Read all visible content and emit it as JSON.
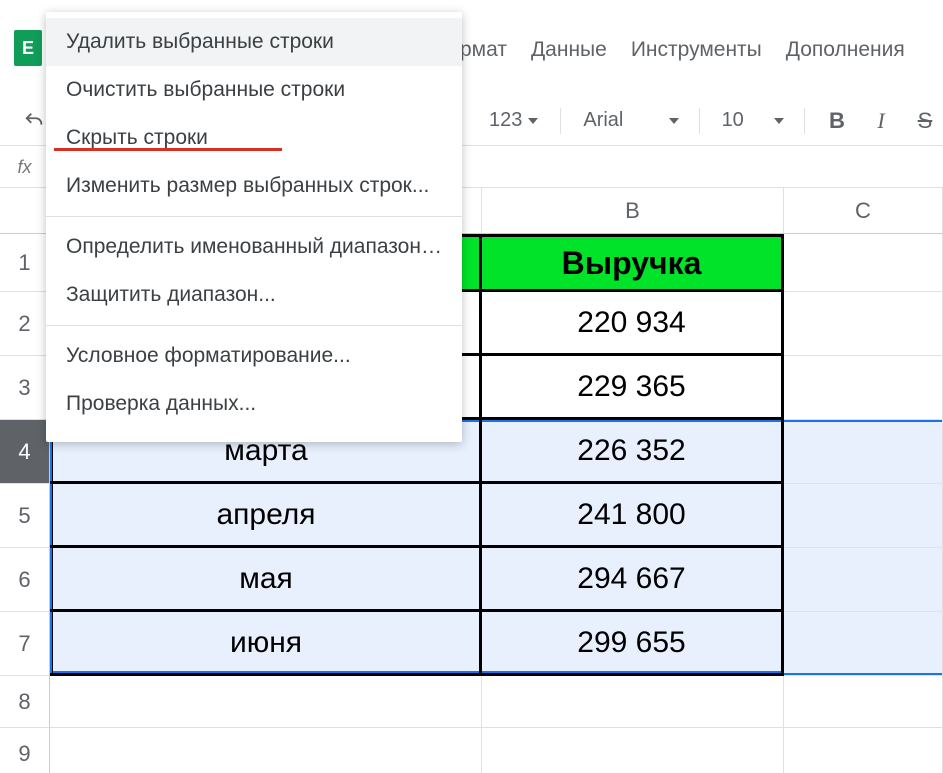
{
  "app_icon_letter": "E",
  "menubar": {
    "format": "рмат",
    "data": "Данные",
    "tools": "Инструменты",
    "addons": "Дополнения"
  },
  "toolbar": {
    "numfmt": "123",
    "font": "Arial",
    "size": "10",
    "bold": "B",
    "italic": "I",
    "strike": "S"
  },
  "formula_bar": {
    "fx": "fx",
    "value": ""
  },
  "columns": {
    "b": "B",
    "c": "C"
  },
  "rows": {
    "labels": [
      "1",
      "2",
      "3",
      "4",
      "5",
      "6",
      "7",
      "8",
      "9"
    ],
    "header": {
      "a": "",
      "b": "Выручка"
    },
    "data": [
      {
        "a": "",
        "b": "220 934"
      },
      {
        "a": "",
        "b": "229 365"
      },
      {
        "a": "марта",
        "b": "226 352"
      },
      {
        "a": "апреля",
        "b": "241 800"
      },
      {
        "a": "мая",
        "b": "294 667"
      },
      {
        "a": "июня",
        "b": "299 655"
      }
    ]
  },
  "context_menu": {
    "delete_rows": "Удалить выбранные строки",
    "clear_rows": "Очистить выбранные строки",
    "hide_rows": "Скрыть строки",
    "resize_rows": "Изменить размер выбранных строк...",
    "named_range": "Определить именованный диапазон…",
    "protect_range": "Защитить диапазон...",
    "cond_format": "Условное форматирование...",
    "data_validation": "Проверка данных..."
  }
}
